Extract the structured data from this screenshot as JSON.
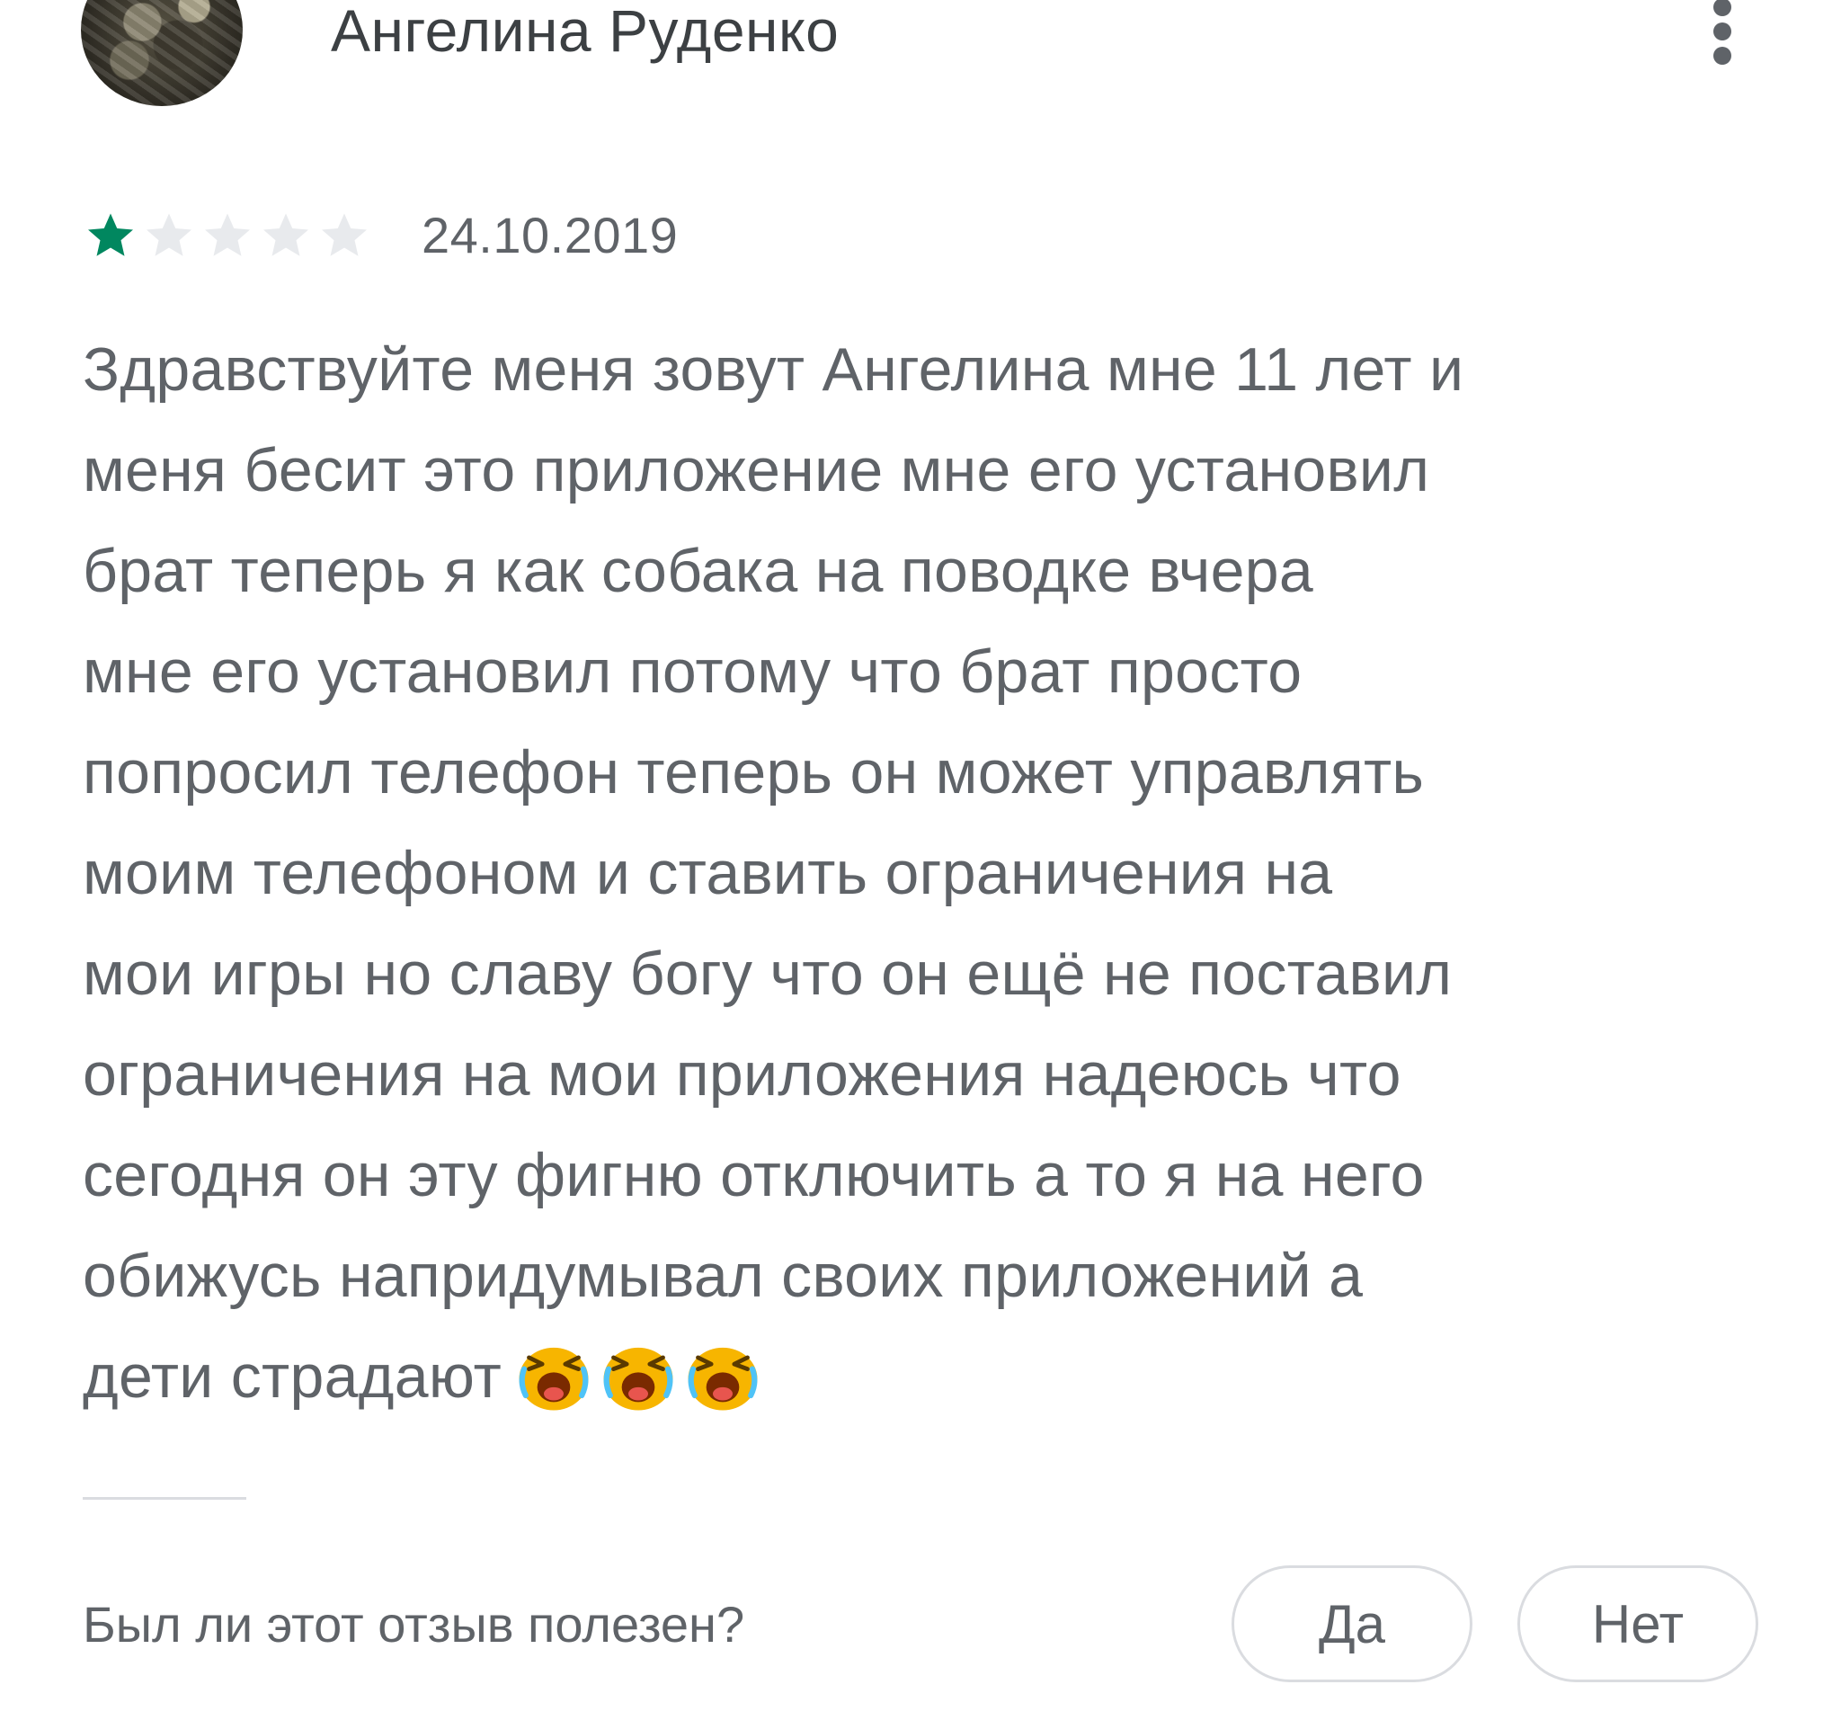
{
  "review": {
    "author_name": "Ангелина Руденко",
    "rating": 1,
    "max_rating": 5,
    "date": "24.10.2019",
    "text_lines": [
      "Здравствуйте меня зовут Ангелина мне 11 лет и",
      "меня бесит это приложение мне его установил",
      "брат теперь я как собака на поводке вчера",
      "мне его установил потому что брат просто",
      "попросил телефон теперь он может управлять",
      "моим телефоном и ставить ограничения на",
      "мои игры но славу богу что он ещё не поставил",
      "ограничения на мои приложения надеюсь что",
      "сегодня он эту фигню отключить а то я на него",
      "обижусь напридумывал своих приложений а",
      "дети страдают"
    ],
    "emojis": [
      "crying-face-icon",
      "crying-face-icon",
      "crying-face-icon"
    ]
  },
  "helpful": {
    "question": "Был ли этот отзыв полезен?",
    "yes_label": "Да",
    "no_label": "Нет"
  },
  "colors": {
    "star_filled": "#01875f",
    "star_empty": "#e8eaed",
    "text": "#5f6368",
    "name": "#3c4043",
    "border": "#dadce0",
    "emoji_face": "#f7b500"
  }
}
